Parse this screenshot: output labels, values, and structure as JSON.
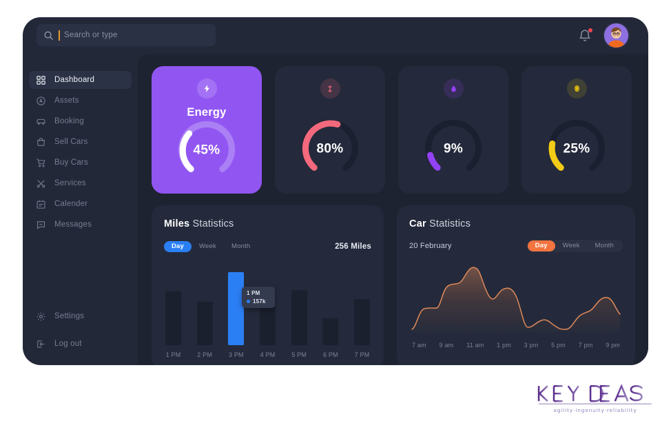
{
  "search": {
    "placeholder": "Search or type",
    "value": ""
  },
  "topbar": {
    "bell_label": "Notifications",
    "avatar_label": "User profile"
  },
  "sidebar": {
    "items": [
      {
        "label": "Dashboard",
        "icon": "grid-icon",
        "active": true
      },
      {
        "label": "Assets",
        "icon": "assets-icon",
        "active": false
      },
      {
        "label": "Booking",
        "icon": "car-icon",
        "active": false
      },
      {
        "label": "Sell Cars",
        "icon": "bag-icon",
        "active": false
      },
      {
        "label": "Buy Cars",
        "icon": "cart-icon",
        "active": false
      },
      {
        "label": "Services",
        "icon": "tools-icon",
        "active": false
      },
      {
        "label": "Calender",
        "icon": "calendar-icon",
        "active": false
      },
      {
        "label": "Messages",
        "icon": "message-icon",
        "active": false
      }
    ],
    "bottom_items": [
      {
        "label": "Settings",
        "icon": "gear-icon"
      },
      {
        "label": "Log out",
        "icon": "logout-icon"
      }
    ]
  },
  "cards": [
    {
      "title": "Energy",
      "value": "45%",
      "percent": 45,
      "icon": "bolt-icon",
      "accent": "#9156f2",
      "arc_color": "#ffffff",
      "track_color": "#ac80f5",
      "featured": true
    },
    {
      "title": "",
      "value": "80%",
      "percent": 80,
      "icon": "arrow-updown-icon",
      "accent": "#f4697d",
      "arc_color": "#f4697d",
      "track_color": "#1b2030",
      "featured": false
    },
    {
      "title": "",
      "value": "9%",
      "percent": 9,
      "icon": "droplet-icon",
      "accent": "#9341f5",
      "arc_color": "#9341f5",
      "track_color": "#1b2030",
      "featured": false
    },
    {
      "title": "",
      "value": "25%",
      "percent": 25,
      "icon": "coin-icon",
      "accent": "#f2cc16",
      "arc_color": "#f2cc16",
      "track_color": "#1b2030",
      "featured": false
    }
  ],
  "miles_panel": {
    "title_bold": "Miles",
    "title_rest": " Statistics",
    "range_options": [
      "Day",
      "Week",
      "Month"
    ],
    "range_selected": "Day",
    "total": "256 Miles",
    "tooltip": {
      "time": "1 PM",
      "value": "157k"
    }
  },
  "car_panel": {
    "title_bold": "Car",
    "title_rest": " Statistics",
    "date": "20 February",
    "range_options": [
      "Day",
      "Week",
      "Month"
    ],
    "range_selected": "Day"
  },
  "logo": {
    "name": "KEYIDEAS",
    "tagline": "agility·ingenuity·reliability"
  },
  "chart_data": [
    {
      "type": "bar",
      "title": "Miles Statistics",
      "categories": [
        "1 PM",
        "2 PM",
        "3 PM",
        "4 PM",
        "5 PM",
        "6 PM",
        "7 PM"
      ],
      "values": [
        97,
        79,
        132,
        68,
        100,
        48,
        84
      ],
      "ylim": [
        0,
        140
      ],
      "highlight_index": 2,
      "highlight_color": "#2b7ff5",
      "bar_color": "#1b202e",
      "xlabel": "",
      "ylabel": "",
      "grid": false,
      "legend": false,
      "annotation": {
        "time": "1 PM",
        "value": "157k"
      }
    },
    {
      "type": "area",
      "title": "Car Statistics",
      "x": [
        "7 am",
        "9 am",
        "11 am",
        "1 pm",
        "3 pm",
        "5 pm",
        "7 pm",
        "9 pm"
      ],
      "values": [
        8,
        38,
        72,
        56,
        12,
        24,
        30,
        52
      ],
      "line_color": "#e08a5a",
      "ylim": [
        0,
        100
      ],
      "xlabel": "",
      "ylabel": "",
      "grid": false,
      "legend": false
    },
    {
      "type": "pie",
      "title": "Energy",
      "categories": [
        "used",
        "remaining"
      ],
      "values": [
        45,
        55
      ],
      "ylabel": "%"
    },
    {
      "type": "pie",
      "title": "",
      "categories": [
        "used",
        "remaining"
      ],
      "values": [
        80,
        20
      ],
      "ylabel": "%"
    },
    {
      "type": "pie",
      "title": "",
      "categories": [
        "used",
        "remaining"
      ],
      "values": [
        9,
        91
      ],
      "ylabel": "%"
    },
    {
      "type": "pie",
      "title": "",
      "categories": [
        "used",
        "remaining"
      ],
      "values": [
        25,
        75
      ],
      "ylabel": "%"
    }
  ]
}
